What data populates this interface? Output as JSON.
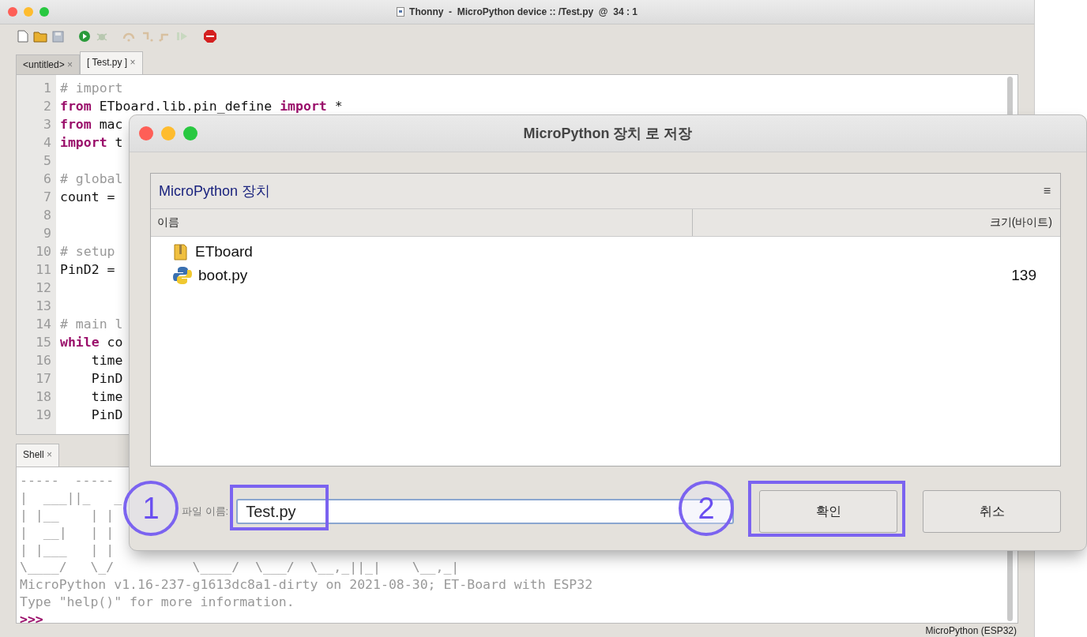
{
  "window": {
    "title": "Thonny  -  MicroPython device :: /Test.py  @  34 : 1"
  },
  "tabs": [
    {
      "label": "<untitled>",
      "close": "×",
      "selected": false
    },
    {
      "label": "[ Test.py ]",
      "close": "×",
      "selected": true
    }
  ],
  "editor": {
    "lines": [
      {
        "number": "1",
        "tokens": [
          {
            "kind": "comment",
            "text": "# import"
          }
        ]
      },
      {
        "number": "2",
        "tokens": [
          {
            "kind": "keyword",
            "text": "from"
          },
          {
            "kind": "plain",
            "text": " ETboard.lib.pin_define "
          },
          {
            "kind": "keyword",
            "text": "import"
          },
          {
            "kind": "plain",
            "text": " *"
          }
        ]
      },
      {
        "number": "3",
        "tokens": [
          {
            "kind": "keyword",
            "text": "from"
          },
          {
            "kind": "plain",
            "text": " mac"
          }
        ]
      },
      {
        "number": "4",
        "tokens": [
          {
            "kind": "keyword",
            "text": "import"
          },
          {
            "kind": "plain",
            "text": " t"
          }
        ]
      },
      {
        "number": "5"
      },
      {
        "number": "6",
        "tokens": [
          {
            "kind": "comment",
            "text": "# global"
          }
        ]
      },
      {
        "number": "7",
        "tokens": [
          {
            "kind": "plain",
            "text": "count = "
          }
        ]
      },
      {
        "number": "8"
      },
      {
        "number": "9"
      },
      {
        "number": "10",
        "tokens": [
          {
            "kind": "comment",
            "text": "# setup"
          }
        ]
      },
      {
        "number": "11",
        "tokens": [
          {
            "kind": "plain",
            "text": "PinD2 = "
          }
        ]
      },
      {
        "number": "12"
      },
      {
        "number": "13"
      },
      {
        "number": "14",
        "tokens": [
          {
            "kind": "comment",
            "text": "# main l"
          }
        ]
      },
      {
        "number": "15",
        "tokens": [
          {
            "kind": "keyword",
            "text": "while"
          },
          {
            "kind": "plain",
            "text": " co"
          }
        ]
      },
      {
        "number": "16",
        "tokens": [
          {
            "kind": "plain",
            "text": "    time"
          }
        ]
      },
      {
        "number": "17",
        "tokens": [
          {
            "kind": "plain",
            "text": "    PinD"
          }
        ]
      },
      {
        "number": "18",
        "tokens": [
          {
            "kind": "plain",
            "text": "    time"
          }
        ]
      },
      {
        "number": "19",
        "tokens": [
          {
            "kind": "plain",
            "text": "    PinD"
          }
        ]
      }
    ]
  },
  "shell": {
    "tab": {
      "label": "Shell",
      "close": "×"
    },
    "lines": [
      {
        "kind": "output",
        "text": "-----  -----"
      },
      {
        "kind": "output",
        "text": "|  ___||_   _"
      },
      {
        "kind": "output",
        "text": "| |__    | |"
      },
      {
        "kind": "output",
        "text": "|  __|   | |"
      },
      {
        "kind": "output",
        "text": "| |___   | |"
      },
      {
        "kind": "output",
        "text": "\\____/   \\_/          \\____/  \\___/  \\__,_||_|    \\__,_|"
      },
      {
        "kind": "output",
        "text": "MicroPython v1.16-237-g1613dc8a1-dirty on 2021-08-30; ET-Board with ESP32"
      },
      {
        "kind": "output",
        "text": "Type \"help()\" for more information."
      },
      {
        "kind": "prompt",
        "text": ">>>"
      }
    ]
  },
  "status_bar": "MicroPython (ESP32)",
  "dialog": {
    "title": "MicroPython 장치 로 저장",
    "location": "MicroPython 장치",
    "menu": "≡",
    "columns": [
      "이름",
      "크기(바이트)"
    ],
    "files": [
      {
        "kind": "folder",
        "name": "ETboard"
      },
      {
        "kind": "python",
        "name": "boot.py",
        "size": "139"
      }
    ],
    "filename_label": "파일 이름:",
    "filename": "Test.py",
    "buttons": [
      "확인",
      "취소"
    ]
  },
  "annotations": [
    {
      "label": "1"
    },
    {
      "label": "2"
    }
  ]
}
